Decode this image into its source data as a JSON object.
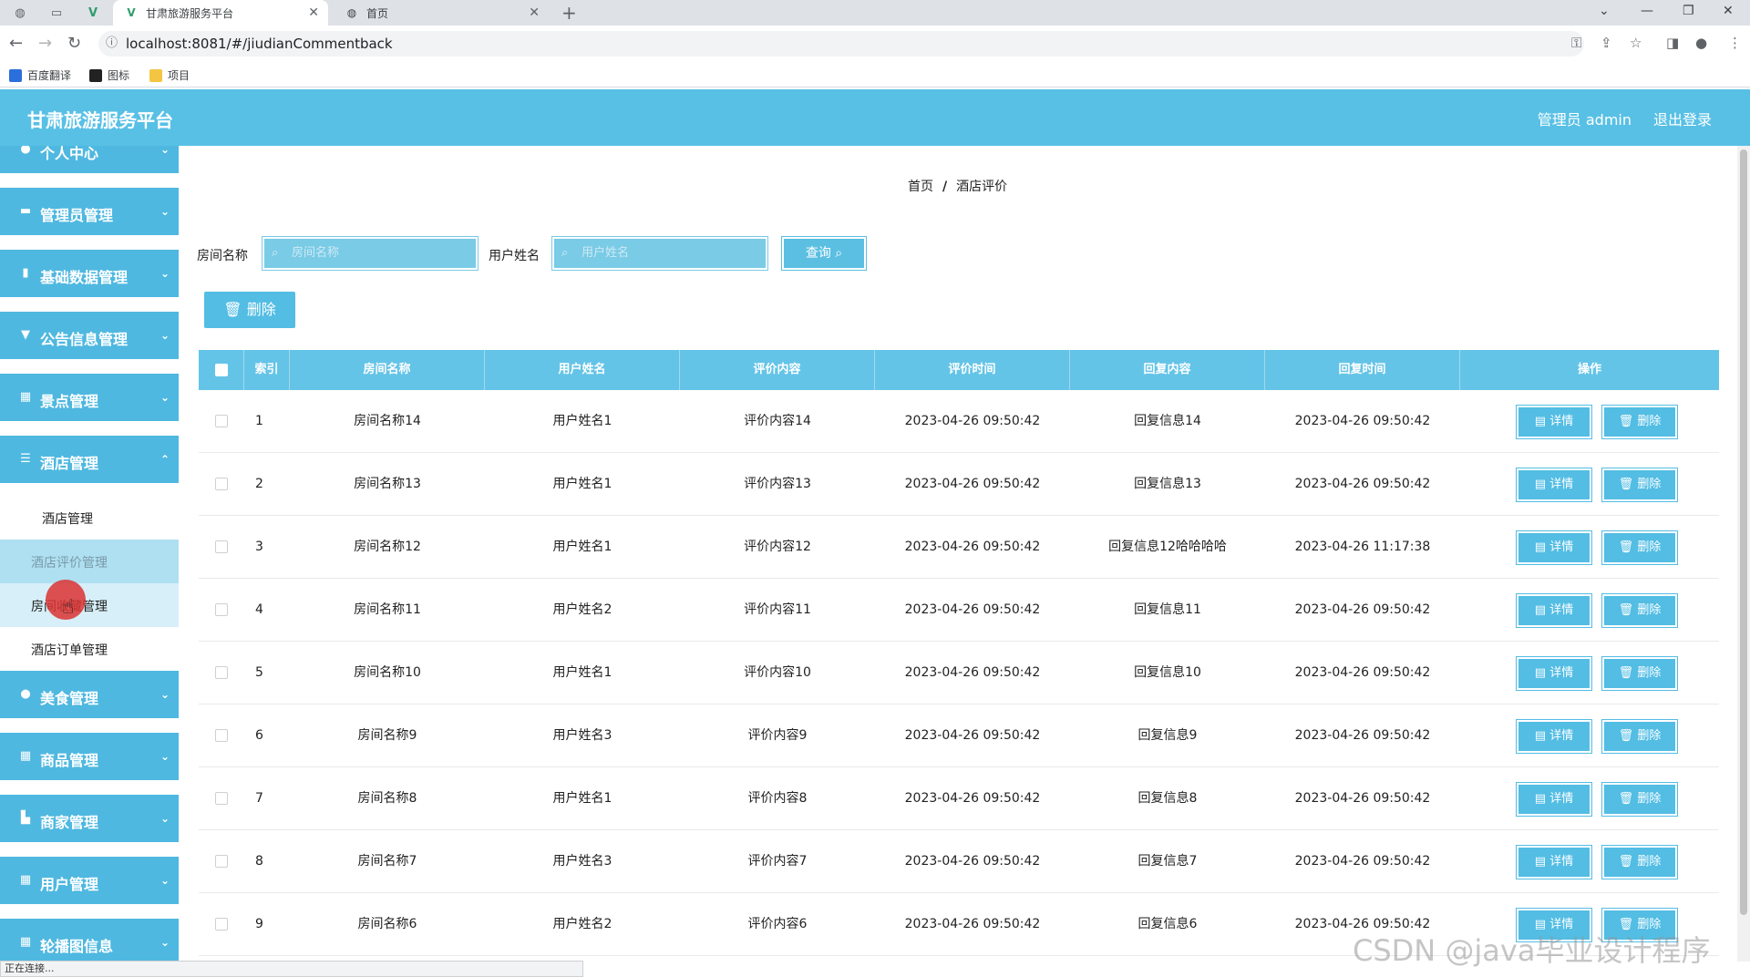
{
  "browser": {
    "tabs": [
      {
        "title": "甘肃旅游服务平台",
        "active": true
      },
      {
        "title": "首页",
        "active": false
      }
    ],
    "url": "localhost:8081/#/jiudianCommentback",
    "bookmarks": [
      "百度翻译",
      "图标",
      "项目"
    ]
  },
  "header": {
    "title": "甘肃旅游服务平台",
    "user": "管理员 admin",
    "logout": "退出登录"
  },
  "sidebar": {
    "menus": [
      {
        "label": "个人中心",
        "icon": "user-icon"
      },
      {
        "label": "管理员管理",
        "icon": "admin-icon"
      },
      {
        "label": "基础数据管理",
        "icon": "data-icon"
      },
      {
        "label": "公告信息管理",
        "icon": "notice-icon"
      },
      {
        "label": "景点管理",
        "icon": "grid-icon"
      },
      {
        "label": "酒店管理",
        "icon": "list-icon"
      }
    ],
    "submenus": [
      {
        "label": "酒店管理"
      },
      {
        "label": "酒店评价管理"
      },
      {
        "label": "房间收藏管理"
      },
      {
        "label": "酒店订单管理"
      }
    ],
    "menus2": [
      {
        "label": "美食管理",
        "icon": "food-icon"
      },
      {
        "label": "商品管理",
        "icon": "grid-icon"
      },
      {
        "label": "商家管理",
        "icon": "shop-icon"
      },
      {
        "label": "用户管理",
        "icon": "grid-icon"
      },
      {
        "label": "轮播图信息",
        "icon": "grid-icon"
      }
    ]
  },
  "breadcrumb": {
    "home": "首页",
    "current": "酒店评价"
  },
  "search": {
    "room_label": "房间名称",
    "room_placeholder": "房间名称",
    "user_label": "用户姓名",
    "user_placeholder": "用户姓名",
    "query_label": "查询"
  },
  "batch_delete": "删除",
  "table": {
    "headers": [
      "索引",
      "房间名称",
      "用户姓名",
      "评价内容",
      "评价时间",
      "回复内容",
      "回复时间",
      "操作"
    ],
    "detail_label": "详情",
    "delete_label": "删除",
    "rows": [
      {
        "idx": "1",
        "room": "房间名称14",
        "user": "用户姓名1",
        "content": "评价内容14",
        "time": "2023-04-26 09:50:42",
        "reply": "回复信息14",
        "reply_time": "2023-04-26 09:50:42"
      },
      {
        "idx": "2",
        "room": "房间名称13",
        "user": "用户姓名1",
        "content": "评价内容13",
        "time": "2023-04-26 09:50:42",
        "reply": "回复信息13",
        "reply_time": "2023-04-26 09:50:42"
      },
      {
        "idx": "3",
        "room": "房间名称12",
        "user": "用户姓名1",
        "content": "评价内容12",
        "time": "2023-04-26 09:50:42",
        "reply": "回复信息12哈哈哈哈",
        "reply_time": "2023-04-26 11:17:38"
      },
      {
        "idx": "4",
        "room": "房间名称11",
        "user": "用户姓名2",
        "content": "评价内容11",
        "time": "2023-04-26 09:50:42",
        "reply": "回复信息11",
        "reply_time": "2023-04-26 09:50:42"
      },
      {
        "idx": "5",
        "room": "房间名称10",
        "user": "用户姓名1",
        "content": "评价内容10",
        "time": "2023-04-26 09:50:42",
        "reply": "回复信息10",
        "reply_time": "2023-04-26 09:50:42"
      },
      {
        "idx": "6",
        "room": "房间名称9",
        "user": "用户姓名3",
        "content": "评价内容9",
        "time": "2023-04-26 09:50:42",
        "reply": "回复信息9",
        "reply_time": "2023-04-26 09:50:42"
      },
      {
        "idx": "7",
        "room": "房间名称8",
        "user": "用户姓名1",
        "content": "评价内容8",
        "time": "2023-04-26 09:50:42",
        "reply": "回复信息8",
        "reply_time": "2023-04-26 09:50:42"
      },
      {
        "idx": "8",
        "room": "房间名称7",
        "user": "用户姓名3",
        "content": "评价内容7",
        "time": "2023-04-26 09:50:42",
        "reply": "回复信息7",
        "reply_time": "2023-04-26 09:50:42"
      },
      {
        "idx": "9",
        "room": "房间名称6",
        "user": "用户姓名2",
        "content": "评价内容6",
        "time": "2023-04-26 09:50:42",
        "reply": "回复信息6",
        "reply_time": "2023-04-26 09:50:42"
      }
    ]
  },
  "status_text": "正在连接...",
  "watermark": "CSDN @java毕业设计程序",
  "colors": {
    "accent": "#58c0e5",
    "menu": "#4fb8e0",
    "table_header": "#64c4e7"
  }
}
